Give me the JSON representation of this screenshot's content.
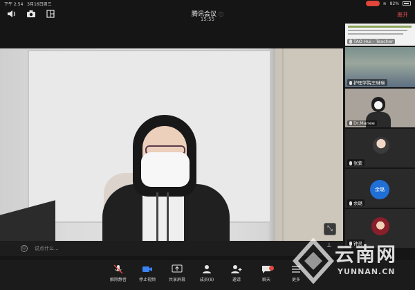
{
  "status": {
    "time": "下午 2:54",
    "date": "3月16日周三",
    "battery": "82%"
  },
  "toolbar": {
    "speaker_icon": "speaker-icon",
    "camera_flip_icon": "camera-flip-icon",
    "share_icon": "share-icon"
  },
  "meeting": {
    "title": "腾讯会议",
    "duration": "15:55",
    "leave_label": "离开"
  },
  "main_video": {
    "chat_placeholder": "说点什么..."
  },
  "participants": [
    {
      "name": "TAO Hui - Teacher",
      "type": "screen"
    },
    {
      "name": "护理学院王琳琳",
      "type": "video"
    },
    {
      "name": "Dr.Manee",
      "type": "video"
    },
    {
      "name": "张紫",
      "type": "photo"
    },
    {
      "name": "余璐",
      "type": "initials",
      "initials": "余璐"
    },
    {
      "name": "钟灵",
      "type": "photo"
    }
  ],
  "bottom": {
    "unmute": "解除静音",
    "stop_video": "停止视频",
    "share_screen": "共享屏幕",
    "members": "成员(8)",
    "invite": "邀请",
    "chat": "聊天",
    "more": "更多"
  },
  "watermark": {
    "brand": "云南网",
    "domain": "YUNNAN.CN"
  },
  "colors": {
    "accent_blue": "#1f6fd6",
    "leave_red": "#e24c4c",
    "record_red": "#e0463a"
  }
}
